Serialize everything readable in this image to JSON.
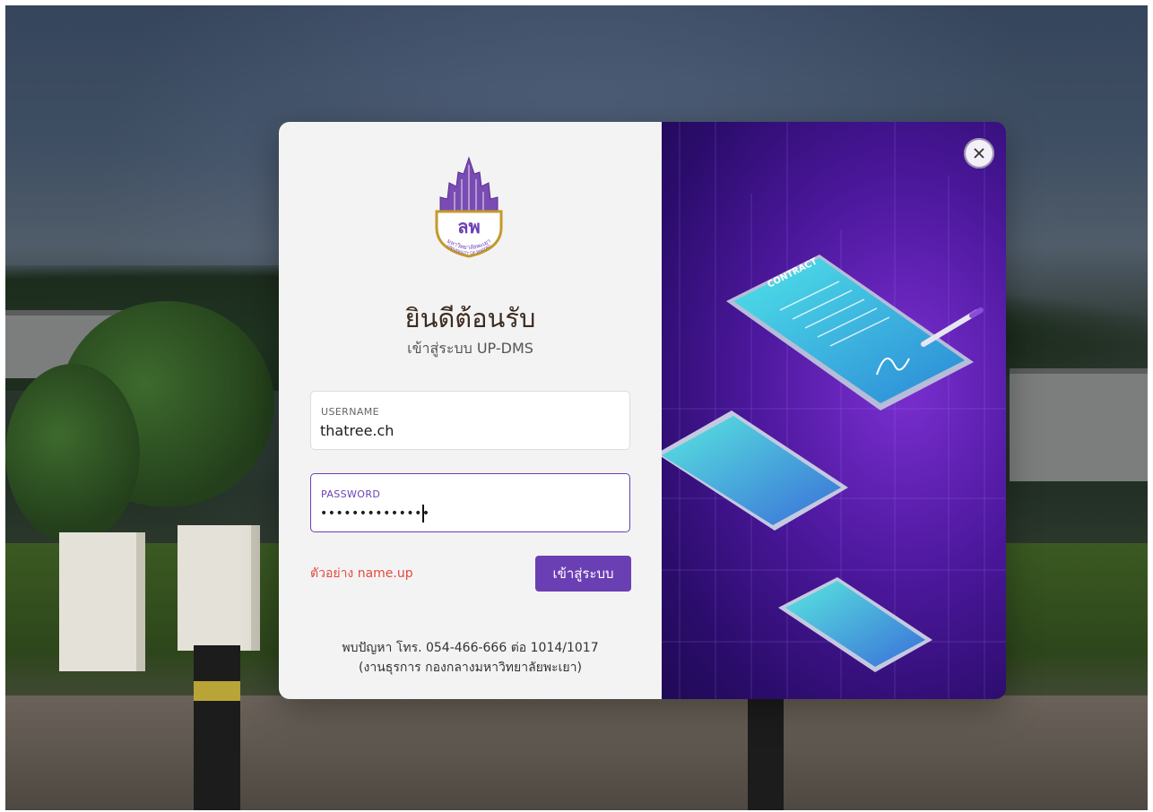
{
  "welcome": {
    "title": "ยินดีต้อนรับ",
    "subtitle": "เข้าสู่ระบบ UP-DMS"
  },
  "form": {
    "username_label": "USERNAME",
    "username_value": "thatree.ch",
    "password_label": "PASSWORD",
    "password_value": "••••••••••••••",
    "hint": "ตัวอย่าง name.up",
    "login_label": "เข้าสู่ระบบ"
  },
  "contact": {
    "line1": "พบปัญหา โทร. 054-466-666 ต่อ 1014/1017",
    "line2": "(งานธุรการ กองกลางมหาวิทยาลัยพะเยา)"
  },
  "logo": {
    "wordmark": "มหาวิทยาลัยพะเยา",
    "subtext": "UNIVERSITY OF PHAYAO",
    "emblem": "ลพ"
  },
  "illustration": {
    "doc_label": "CONTRACT"
  },
  "colors": {
    "accent": "#6b3fb4",
    "hint": "#e24b3b",
    "panel_dark": "#2a0c6a"
  },
  "icons": {
    "close": "close-icon"
  }
}
